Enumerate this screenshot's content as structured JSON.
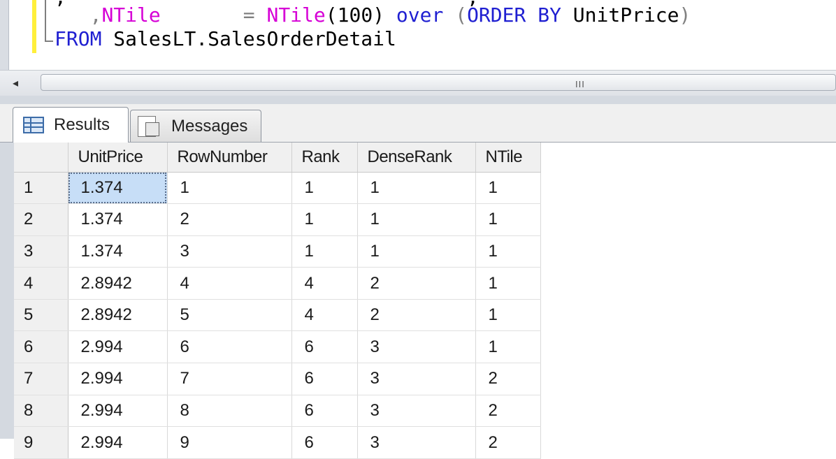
{
  "editor": {
    "line_partial": ",                                  ,                 ",
    "line1": {
      "prefix": "   ,",
      "col_name": "NTile",
      "spaces": "       ",
      "equals": "= ",
      "fn": "NTile",
      "args": "(100) ",
      "over": "over",
      "open": " (",
      "order_by": "ORDER BY",
      "col": " UnitPrice",
      "close": ")"
    },
    "line2": {
      "from": "FROM",
      "table": " SalesLT.SalesOrderDetail"
    }
  },
  "scrollbar": {
    "left_arrow": "◂",
    "grip": "III"
  },
  "tabs": [
    {
      "label": "Results",
      "icon": "grid-icon",
      "active": true
    },
    {
      "label": "Messages",
      "icon": "messages-icon",
      "active": false
    }
  ],
  "results": {
    "columns": [
      "UnitPrice",
      "RowNumber",
      "Rank",
      "DenseRank",
      "NTile"
    ],
    "rows": [
      [
        "1",
        "1.374",
        "1",
        "1",
        "1",
        "1"
      ],
      [
        "2",
        "1.374",
        "2",
        "1",
        "1",
        "1"
      ],
      [
        "3",
        "1.374",
        "3",
        "1",
        "1",
        "1"
      ],
      [
        "4",
        "2.8942",
        "4",
        "4",
        "2",
        "1"
      ],
      [
        "5",
        "2.8942",
        "5",
        "4",
        "2",
        "1"
      ],
      [
        "6",
        "2.994",
        "6",
        "6",
        "3",
        "1"
      ],
      [
        "7",
        "2.994",
        "7",
        "6",
        "3",
        "2"
      ],
      [
        "8",
        "2.994",
        "8",
        "6",
        "3",
        "2"
      ],
      [
        "9",
        "2.994",
        "9",
        "6",
        "3",
        "2"
      ]
    ]
  },
  "colors": {
    "keyword_blue": "#1f1fd1",
    "function_pink": "#d600d6",
    "selection": "#c7def7"
  }
}
